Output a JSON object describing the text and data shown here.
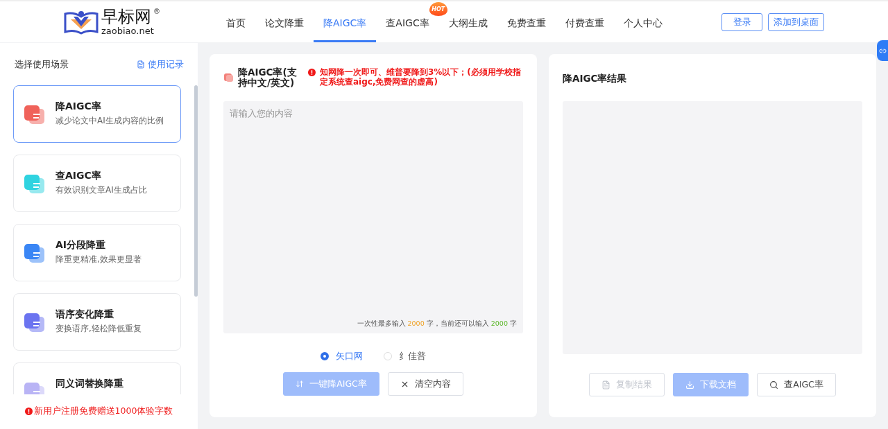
{
  "logo": {
    "name": "早标网",
    "mark": "®",
    "domain": "zaobiao.net"
  },
  "nav": [
    {
      "label": "首页",
      "selected": false,
      "hot": false
    },
    {
      "label": "论文降重",
      "selected": false,
      "hot": false
    },
    {
      "label": "降AIGC率",
      "selected": true,
      "hot": false
    },
    {
      "label": "查AIGC率",
      "selected": false,
      "hot": true,
      "badge": "HOT"
    },
    {
      "label": "大纲生成",
      "selected": false,
      "hot": false
    },
    {
      "label": "免费查重",
      "selected": false,
      "hot": false
    },
    {
      "label": "付费查重",
      "selected": false,
      "hot": false
    },
    {
      "label": "个人中心",
      "selected": false,
      "hot": false
    }
  ],
  "header_buttons": [
    "登录",
    "添加到桌面"
  ],
  "sidebar": {
    "title": "选择使用场景",
    "history_link": "使用记录",
    "items": [
      {
        "title": "降AIGC率",
        "subtitle": "减少论文中AI生成内容的比例",
        "selected": true,
        "color": "#f0625a"
      },
      {
        "title": "查AIGC率",
        "subtitle": "有效识别文章AI生成占比",
        "selected": false,
        "color": "#2fd3e0"
      },
      {
        "title": "AI分段降重",
        "subtitle": "降重更精准,效果更显著",
        "selected": false,
        "color": "#3a86f5"
      },
      {
        "title": "语序变化降重",
        "subtitle": "变换语序,轻松降低重复",
        "selected": false,
        "color": "#6b74f0"
      },
      {
        "title": "同义词替换降重",
        "selected": false,
        "color": "#b9b4f5"
      }
    ],
    "notice": "新用户注册免费赠送1000体验字数"
  },
  "editor": {
    "title": "降AIGC率(支持中文/英文)",
    "warning": "知网降一次即可、维普要降到3%以下；(必须用学校指定系统查aigc,免费网查的虚高)",
    "placeholder": "请输入您的内容",
    "counter": {
      "prefix": "一次性最多输入",
      "max": "2000",
      "middle": "字，当前还可以输入",
      "remaining": "2000",
      "suffix": "字"
    },
    "platforms": [
      {
        "label": "矢口网",
        "selected": true
      },
      {
        "label": "纟佳普",
        "selected": false
      }
    ],
    "buttons": [
      {
        "label": "一键降AIGC率",
        "kind": "primary",
        "disabled": true
      },
      {
        "label": "清空内容",
        "kind": "clear",
        "disabled": false
      }
    ]
  },
  "result": {
    "title": "降AIGC率结果",
    "buttons": [
      {
        "label": "复制结果",
        "kind": "copy",
        "disabled": true
      },
      {
        "label": "下载文档",
        "kind": "download",
        "disabled": true
      },
      {
        "label": "查AIGC率",
        "kind": "check",
        "disabled": false
      }
    ]
  }
}
